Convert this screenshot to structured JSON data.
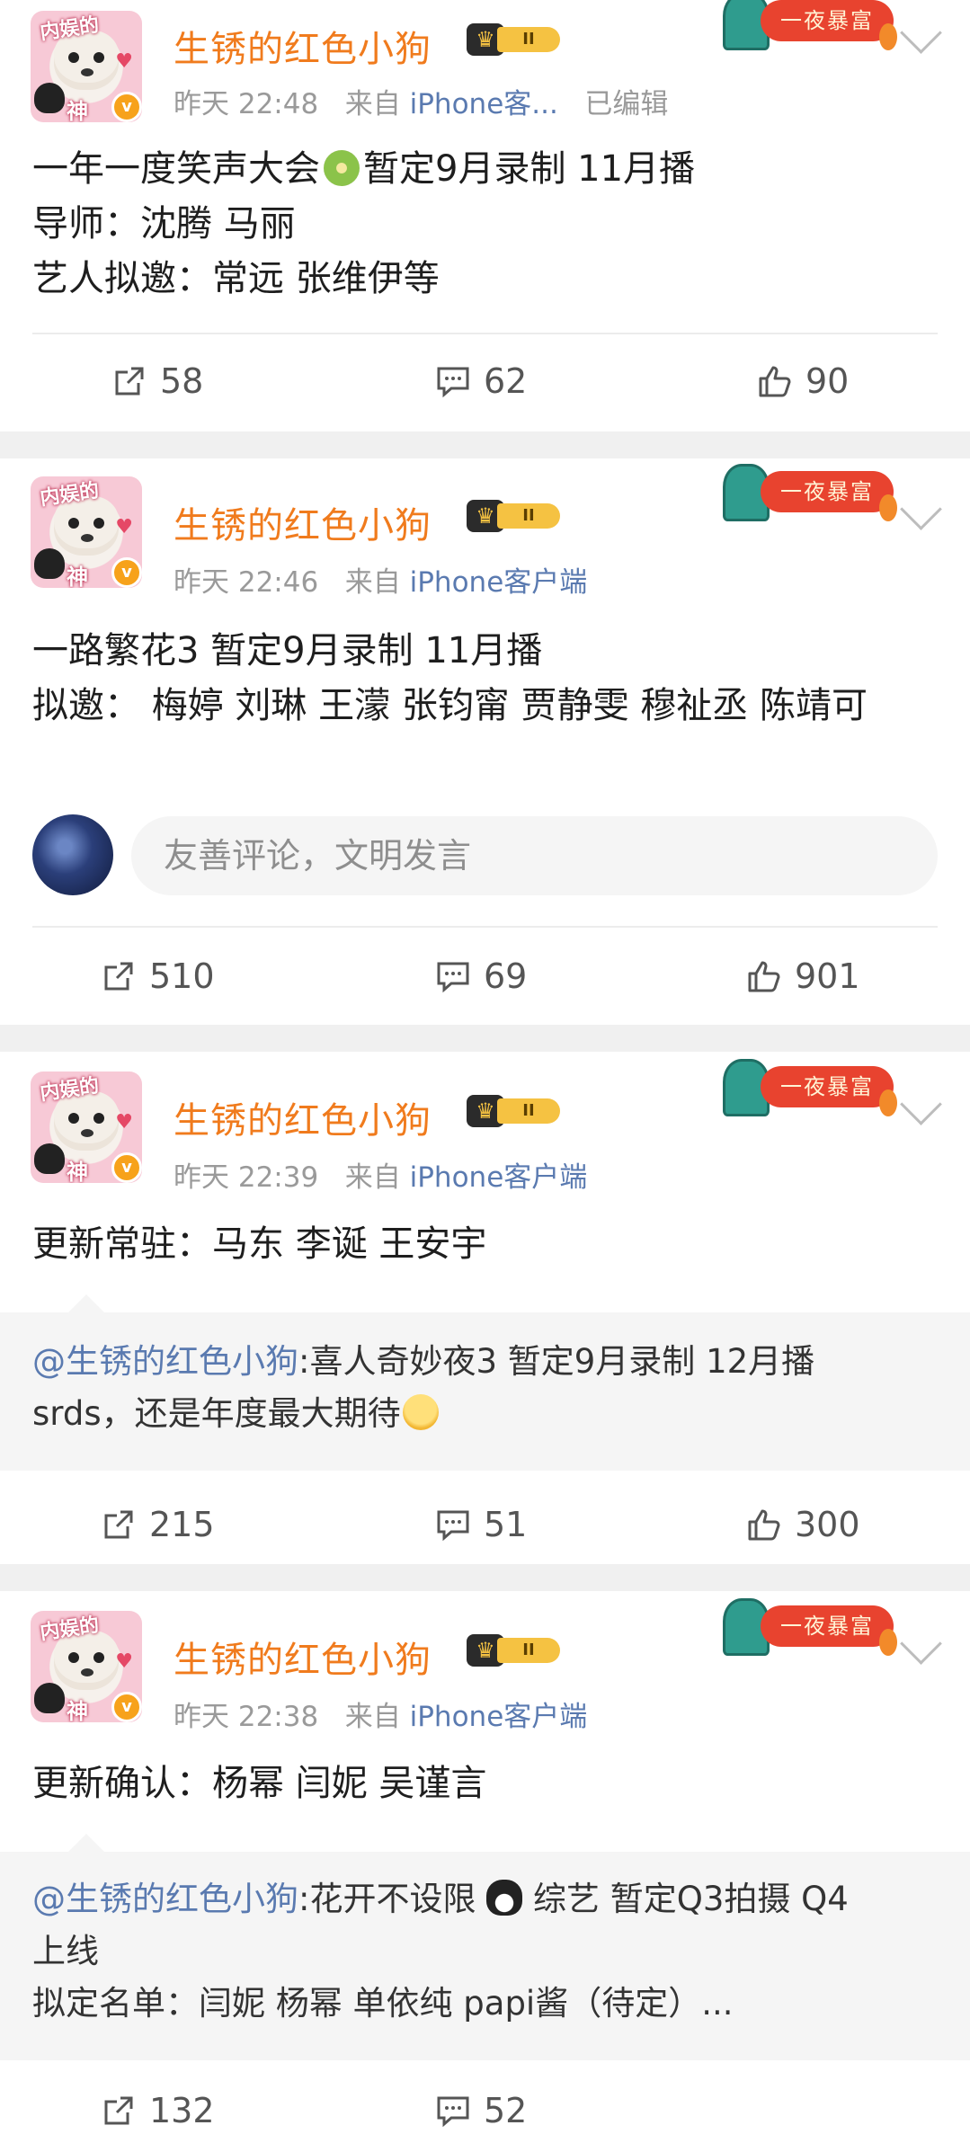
{
  "posts": [
    {
      "username": "生锈的红色小狗",
      "avatar_text_top": "内娱的",
      "avatar_text_bottom": "神",
      "verified_badge": "v",
      "level_badge": "II",
      "time": "昨天 22:48",
      "source_prefix": "来自",
      "source": "iPhone客...",
      "edited": "已编辑",
      "decor_label": "一夜暴富",
      "lines": [
        "一年一度笑声大会",
        "暂定9月录制 11月播",
        "导师：沈腾 马丽",
        "艺人拟邀：常远 张维伊等"
      ],
      "emoji": "kiwi-emoji",
      "actions": {
        "repost": "58",
        "comment": "62",
        "like": "90"
      }
    },
    {
      "username": "生锈的红色小狗",
      "avatar_text_top": "内娱的",
      "avatar_text_bottom": "神",
      "verified_badge": "v",
      "level_badge": "II",
      "time": "昨天 22:46",
      "source_prefix": "来自",
      "source": "iPhone客户端",
      "decor_label": "一夜暴富",
      "lines": [
        "一路繁花3 暂定9月录制 11月播",
        "拟邀： 梅婷 刘琳 王濛 张钧甯 贾静雯 穆祉丞 陈靖可"
      ],
      "comment_placeholder": "友善评论，文明发言",
      "actions": {
        "repost": "510",
        "comment": "69",
        "like": "901"
      }
    },
    {
      "username": "生锈的红色小狗",
      "avatar_text_top": "内娱的",
      "avatar_text_bottom": "神",
      "verified_badge": "v",
      "level_badge": "II",
      "time": "昨天 22:39",
      "source_prefix": "来自",
      "source": "iPhone客户端",
      "decor_label": "一夜暴富",
      "lines": [
        "更新常驻：马东 李诞 王安宇"
      ],
      "quote_at": "@生锈的红色小狗",
      "quote_lines": [
        ":喜人奇妙夜3 暂定9月录制 12月播",
        "srds，还是年度最大期待"
      ],
      "actions": {
        "repost": "215",
        "comment": "51",
        "like": "300"
      }
    },
    {
      "username": "生锈的红色小狗",
      "avatar_text_top": "内娱的",
      "avatar_text_bottom": "神",
      "verified_badge": "v",
      "level_badge": "II",
      "time": "昨天 22:38",
      "source_prefix": "来自",
      "source": "iPhone客户端",
      "decor_label": "一夜暴富",
      "lines": [
        "更新确认：杨幂 闫妮 吴谨言"
      ],
      "quote_at": "@生锈的红色小狗",
      "quote_lines": [
        ":花开不设限",
        "综艺 暂定Q3拍摄 Q4",
        "上线",
        "拟定名单：闫妮 杨幂 单依纯 papi酱（待定）..."
      ],
      "actions": {
        "repost": "132",
        "comment": "52"
      }
    }
  ],
  "colors": {
    "username": "#f07b1d",
    "link": "#5a7ab0",
    "meta": "#9a9a9a",
    "separator": "#f0f0f0",
    "quote_bg": "#f5f5f5"
  }
}
